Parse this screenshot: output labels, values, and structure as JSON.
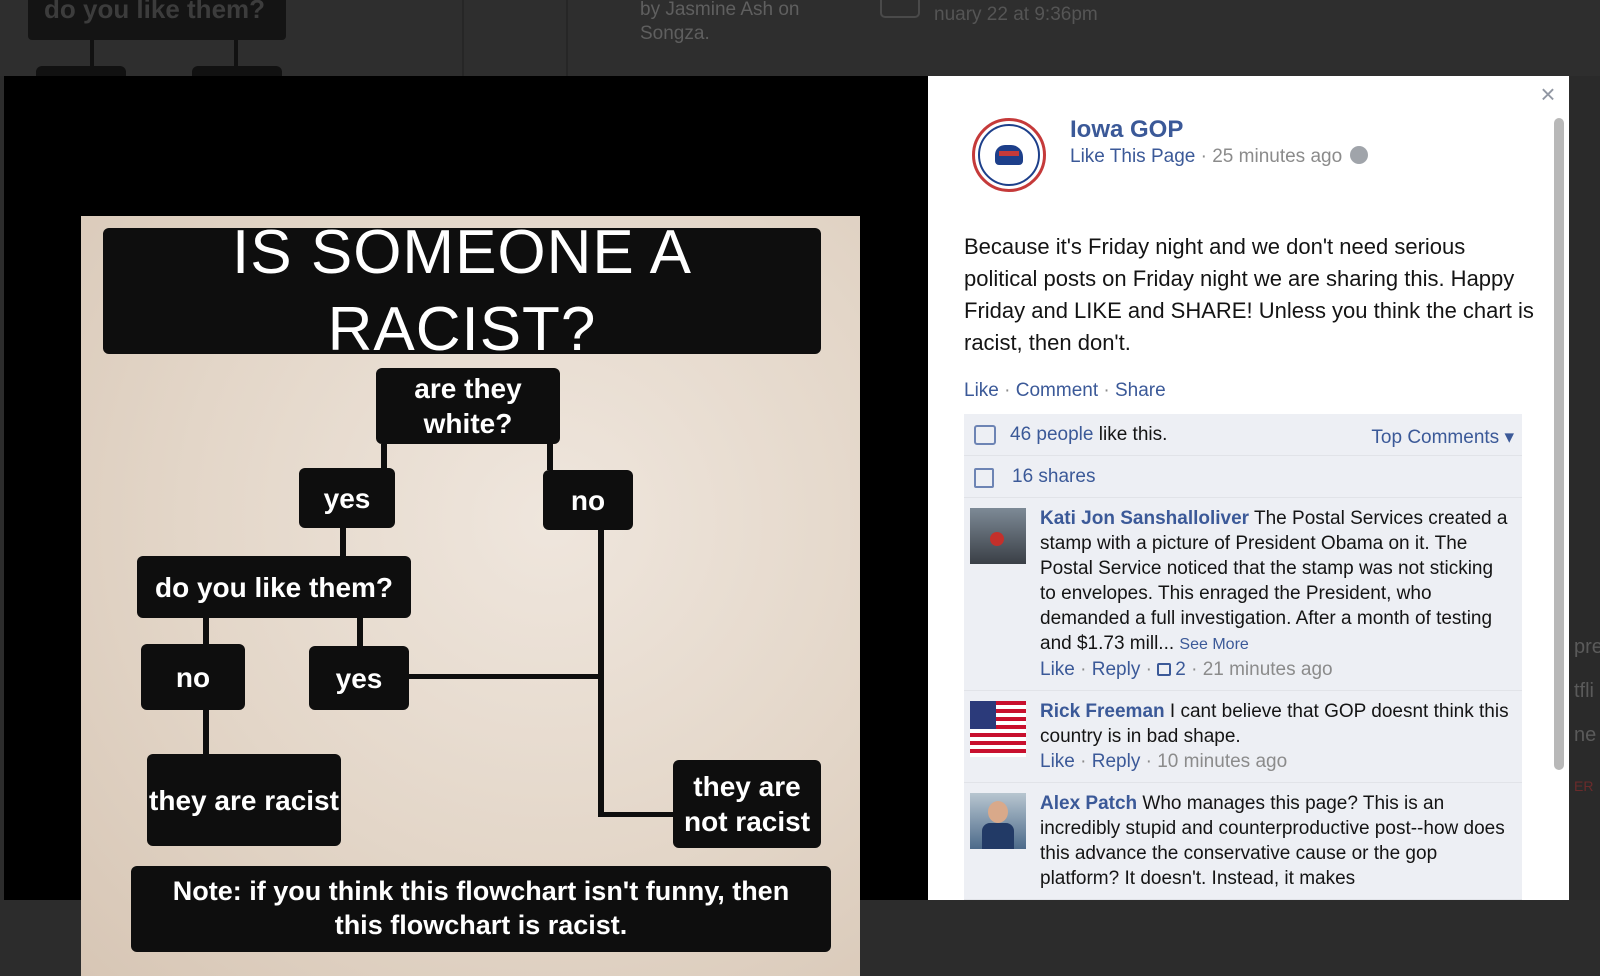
{
  "background": {
    "chart_fragment": "do you like them?",
    "text_fragment": "by Jasmine Ash on Songza.",
    "date_fragment": "nuary 22 at 9:36pm",
    "right_fragments": [
      "pre",
      "tfli",
      "ne",
      "ER"
    ]
  },
  "meme": {
    "title": "IS SOMEONE A RACIST?",
    "q1": "are they white?",
    "yes1": "yes",
    "no1": "no",
    "q2": "do you like them?",
    "no2": "no",
    "yes2": "yes",
    "result_racist": "they are racist",
    "result_not_racist": "they are not racist",
    "note": "Note: if you think this flowchart isn't funny, then this flowchart is racist."
  },
  "panel": {
    "close_glyph": "×",
    "page_name": "Iowa GOP",
    "like_page": "Like This Page",
    "separator": " · ",
    "time": "25 minutes ago",
    "post_text": "Because it's Friday night and we don't need serious political posts on Friday night we are sharing this. Happy Friday and LIKE and SHARE! Unless you think the chart is racist, then don't.",
    "actions": {
      "like": "Like",
      "comment": "Comment",
      "share": "Share"
    },
    "likes": {
      "people": "46 people",
      "suffix": " like this."
    },
    "top_comments": "Top Comments ▾",
    "shares": "16 shares",
    "comments": [
      {
        "name": "Kati Jon Sanshalloliver",
        "text": " The Postal Services created a stamp with a picture of President Obama on it. The Postal Service noticed that the stamp was not sticking to envelopes. This enraged the President, who demanded a full investigation. After a month of testing and $1.73 mill... ",
        "see_more": "See More",
        "like": "Like",
        "reply": "Reply",
        "like_count": "2",
        "time": "21 minutes ago"
      },
      {
        "name": "Rick Freeman",
        "text": " I cant believe that GOP doesnt think this country is in bad shape.",
        "like": "Like",
        "reply": "Reply",
        "time": "10 minutes ago"
      },
      {
        "name": "Alex Patch",
        "text": " Who manages this page? This is an incredibly stupid and counterproductive post--how does this advance the conservative cause or the gop platform? It doesn't. Instead, it makes"
      }
    ]
  }
}
